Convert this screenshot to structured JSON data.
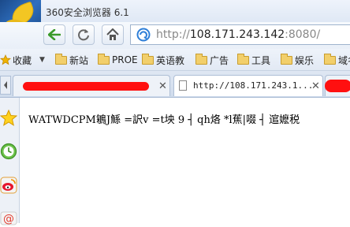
{
  "window": {
    "title": "360安全浏览器 6.1"
  },
  "navigation": {
    "back_icon": "back-arrow-icon",
    "refresh_icon": "refresh-icon",
    "home_icon": "home-icon",
    "address": {
      "scheme": "http://",
      "host": "108.171.243.142",
      "port": ":8080/"
    }
  },
  "bookmarks": {
    "favorites_label": "收藏",
    "items": [
      {
        "label": "新站"
      },
      {
        "label": "PROE"
      },
      {
        "label": "英语教"
      },
      {
        "label": "广告"
      },
      {
        "label": "工具"
      },
      {
        "label": "娱乐"
      },
      {
        "label": "域名"
      }
    ]
  },
  "tabs": [
    {
      "title": "",
      "redacted": true
    },
    {
      "title": "http://108.171.243.1...",
      "redacted": false
    },
    {
      "title": "",
      "redacted": true
    }
  ],
  "sidebar": {
    "icons": [
      "star-icon",
      "clock-icon",
      "weibo-icon",
      "mail-icon"
    ]
  },
  "page": {
    "body_text": "WATWDCPM鵴J鯀 =訳v =t坱 9 ┤ qh烙 *l蕉|啜 ┤ 逭嬷税"
  },
  "colors": {
    "accent": "#2f7fd8",
    "nav_green": "#3a9a2a",
    "redaction": "#ff1010"
  }
}
